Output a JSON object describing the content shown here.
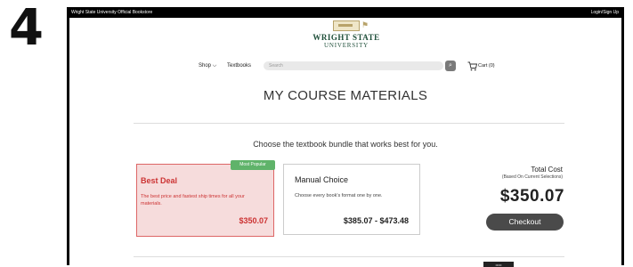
{
  "step_number": "4",
  "topbar": {
    "site_name": "Wright State University Official Bookstore",
    "login": "Login/Sign Up"
  },
  "logo": {
    "line1": "WRIGHT STATE",
    "line2": "UNIVERSITY"
  },
  "nav": {
    "shop": "Shop",
    "shop_chevron": "⌵",
    "textbooks": "Textbooks"
  },
  "search": {
    "placeholder": "Search"
  },
  "cart": {
    "label": "Cart (0)"
  },
  "page_title": "MY COURSE MATERIALS",
  "subtitle": "Choose the textbook bundle that works best for you.",
  "best_deal": {
    "badge": "Most Popular",
    "title": "Best Deal",
    "description": "The best price and fastest ship times for all your materials.",
    "price": "$350.07"
  },
  "manual_choice": {
    "title": "Manual Choice",
    "description": "Choose every book's format one by one.",
    "price": "$385.07 - $473.48"
  },
  "total": {
    "label": "Total Cost",
    "sublabel": "(Based On Current Selections)",
    "price": "$350.07"
  },
  "checkout_label": "Checkout",
  "chip_label": "•••••",
  "colors": {
    "accent_red": "#cc3333",
    "badge_green": "#5fb36a",
    "arrow_gold": "#d49a3a"
  }
}
